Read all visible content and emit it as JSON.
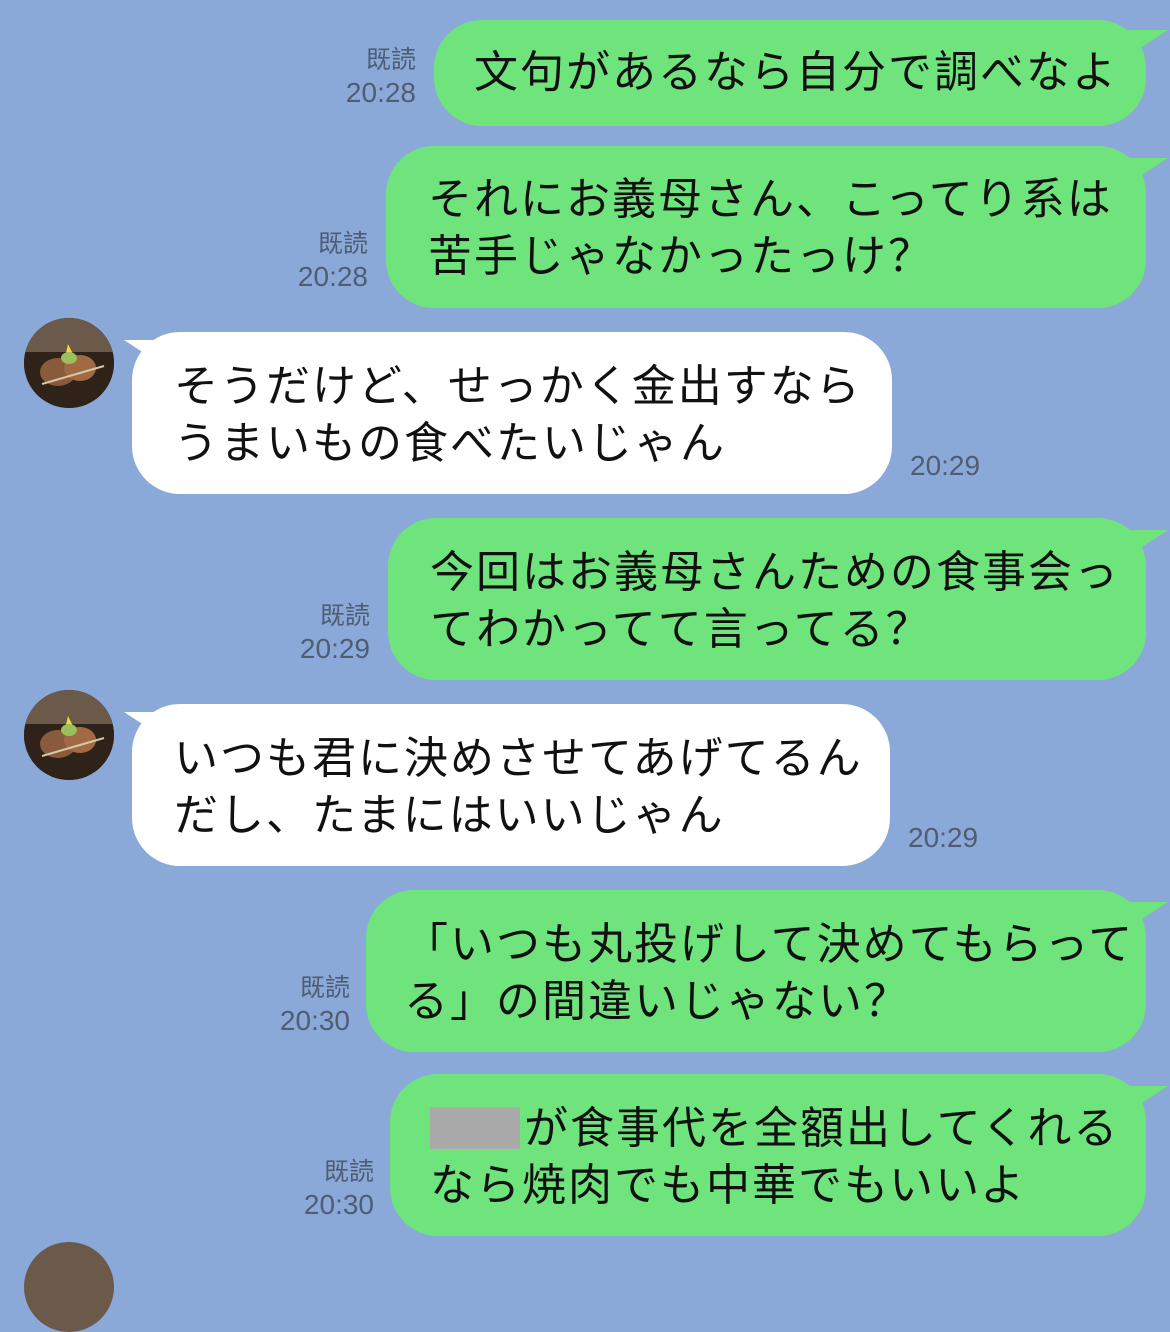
{
  "chat": {
    "messages": [
      {
        "side": "out",
        "read": "既読",
        "time": "20:28",
        "lines": [
          "文句があるなら自分で調べなよ"
        ]
      },
      {
        "side": "out",
        "read": "既読",
        "time": "20:28",
        "lines": [
          "それにお義母さん、こってり系は",
          "苦手じゃなかったっけ？"
        ]
      },
      {
        "side": "in",
        "time": "20:29",
        "lines": [
          "そうだけど、せっかく金出すなら",
          "うまいもの食べたいじゃん"
        ]
      },
      {
        "side": "out",
        "read": "既読",
        "time": "20:29",
        "lines": [
          "今回はお義母さんための食事会っ",
          "てわかってて言ってる？"
        ]
      },
      {
        "side": "in",
        "time": "20:29",
        "lines": [
          "いつも君に決めさせてあげてるん",
          "だし、たまにはいいじゃん"
        ]
      },
      {
        "side": "out",
        "read": "既読",
        "time": "20:30",
        "lines": [
          "「いつも丸投げして決めてもらって",
          "る」の間違いじゃない？"
        ]
      },
      {
        "side": "out",
        "read": "既読",
        "time": "20:30",
        "lines": [
          "が食事代を全額出してくれる",
          "なら焼肉でも中華でもいいよ"
        ]
      }
    ]
  },
  "colors": {
    "background": "#8aa9d8",
    "sent_bubble": "#6fe47d",
    "received_bubble": "#ffffff",
    "meta_text": "#4f5d73"
  },
  "icons": {
    "avatar": "food-skewer-avatar"
  }
}
